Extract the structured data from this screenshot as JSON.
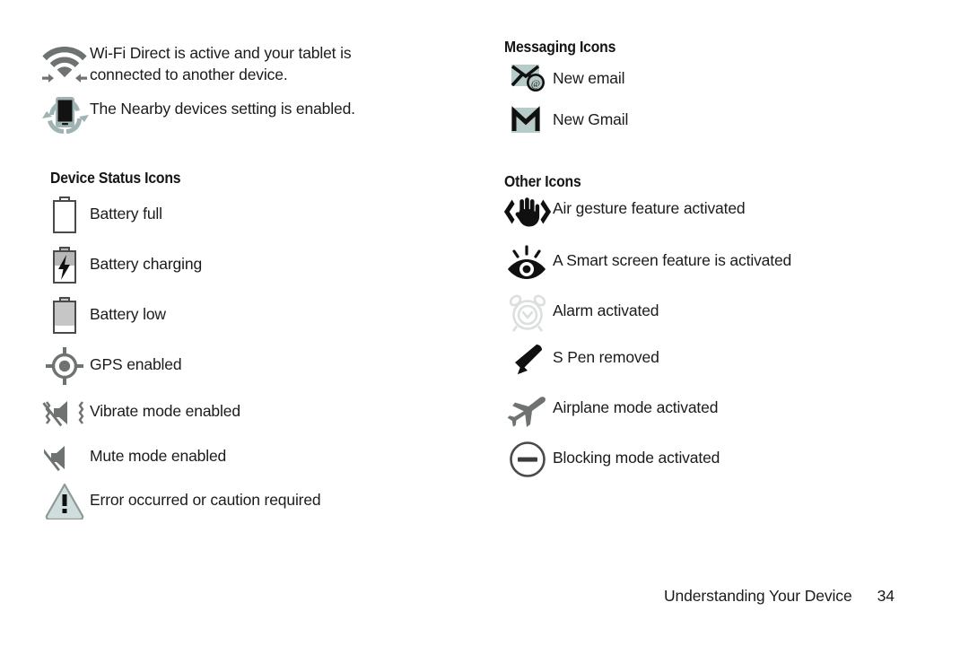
{
  "page": {
    "footer_title": "Understanding Your Device",
    "page_number": "34"
  },
  "colors": {
    "gray_icon": "#6e7372",
    "dark_icon": "#101010",
    "pale_teal": "#b7cbc9",
    "light_outline": "#d9dede",
    "text": "#1b1b1b"
  },
  "left_column": {
    "intro_rows": [
      {
        "icon": "wifi-direct-icon",
        "text": "Wi-Fi Direct is active and your tablet is\nconnected to another device."
      },
      {
        "icon": "nearby-devices-icon",
        "text": "The Nearby devices setting is enabled."
      }
    ],
    "heading": "Device Status Icons",
    "rows": [
      {
        "icon": "battery-full-icon",
        "text": "Battery full"
      },
      {
        "icon": "battery-charging-icon",
        "text": "Battery charging"
      },
      {
        "icon": "battery-low-icon",
        "text": "Battery low"
      },
      {
        "icon": "gps-icon",
        "text": "GPS enabled"
      },
      {
        "icon": "vibrate-icon",
        "text": "Vibrate mode enabled"
      },
      {
        "icon": "mute-icon",
        "text": "Mute mode enabled"
      },
      {
        "icon": "caution-icon",
        "text": "Error occurred or caution required"
      }
    ]
  },
  "right_column": {
    "messaging_heading": "Messaging Icons",
    "messaging_rows": [
      {
        "icon": "new-email-icon",
        "text": "New email"
      },
      {
        "icon": "new-gmail-icon",
        "text": "New Gmail"
      }
    ],
    "other_heading": "Other Icons",
    "other_rows": [
      {
        "icon": "air-gesture-icon",
        "text": "Air gesture feature activated"
      },
      {
        "icon": "smart-screen-icon",
        "text": "A Smart screen feature is activated"
      },
      {
        "icon": "alarm-icon",
        "text": "Alarm activated"
      },
      {
        "icon": "s-pen-icon",
        "text": "S Pen removed"
      },
      {
        "icon": "airplane-mode-icon",
        "text": "Airplane mode activated"
      },
      {
        "icon": "blocking-mode-icon",
        "text": "Blocking mode activated"
      }
    ]
  }
}
